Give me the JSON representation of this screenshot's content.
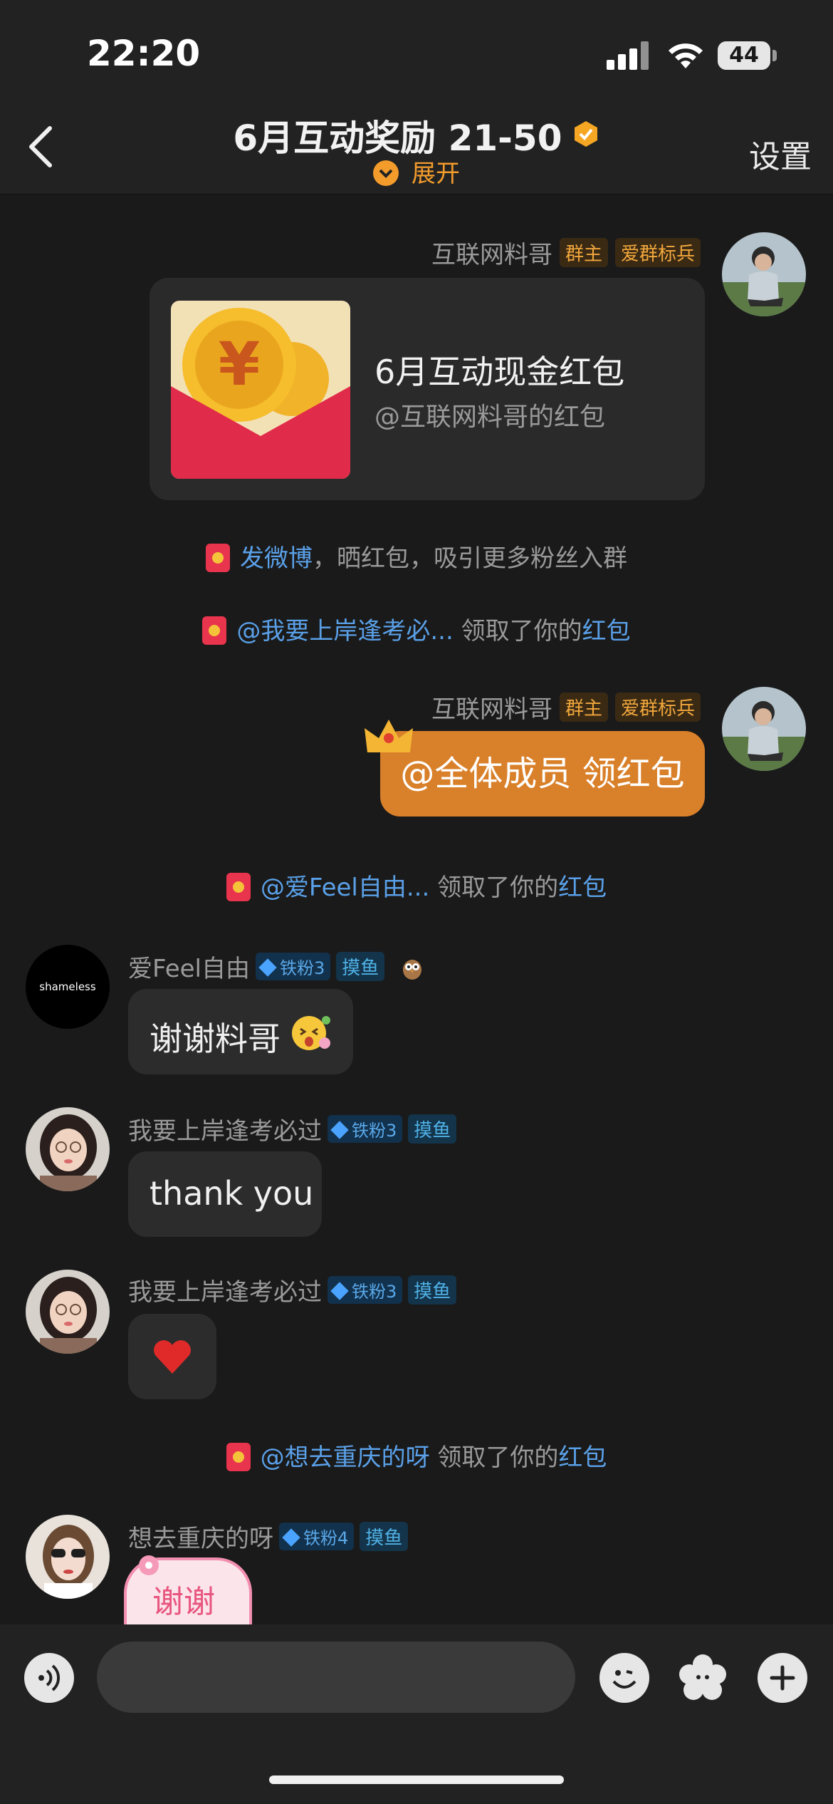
{
  "status": {
    "time": "22:20",
    "battery": "44"
  },
  "nav": {
    "title": "6月互动奖励 21-50",
    "expand": "展开",
    "settings": "设置"
  },
  "messages": {
    "owner_name": "互联网料哥",
    "owner_tag": "群主",
    "owner_badge": "爱群标兵",
    "packet_title": "6月互动现金红包",
    "packet_sub": "@互联网料哥的红包",
    "all_members": "@全体成员 领红包"
  },
  "system": {
    "post_link": "发微博",
    "post_rest": "，晒红包，吸引更多粉丝入群",
    "claim1_user": "@我要上岸逢考必...",
    "claim2_user": "@爱Feel自由...",
    "claim3_user": "@想去重庆的呀",
    "claimed_text": " 领取了你的",
    "red_packet": "红包"
  },
  "users": {
    "u1_name": "爱Feel自由",
    "u1_fan": "铁粉3",
    "u1_avatar_text": "shameless",
    "u1_msg": "谢谢料哥",
    "u2_name": "我要上岸逢考必过",
    "u2_fan": "铁粉3",
    "u2_msg": "thank you",
    "u3_name": "我要上岸逢考必过",
    "u3_fan": "铁粉3",
    "u4_name": "想去重庆的呀",
    "u4_fan": "铁粉4",
    "u4_msg": "谢谢",
    "fish_tag": "摸鱼"
  }
}
